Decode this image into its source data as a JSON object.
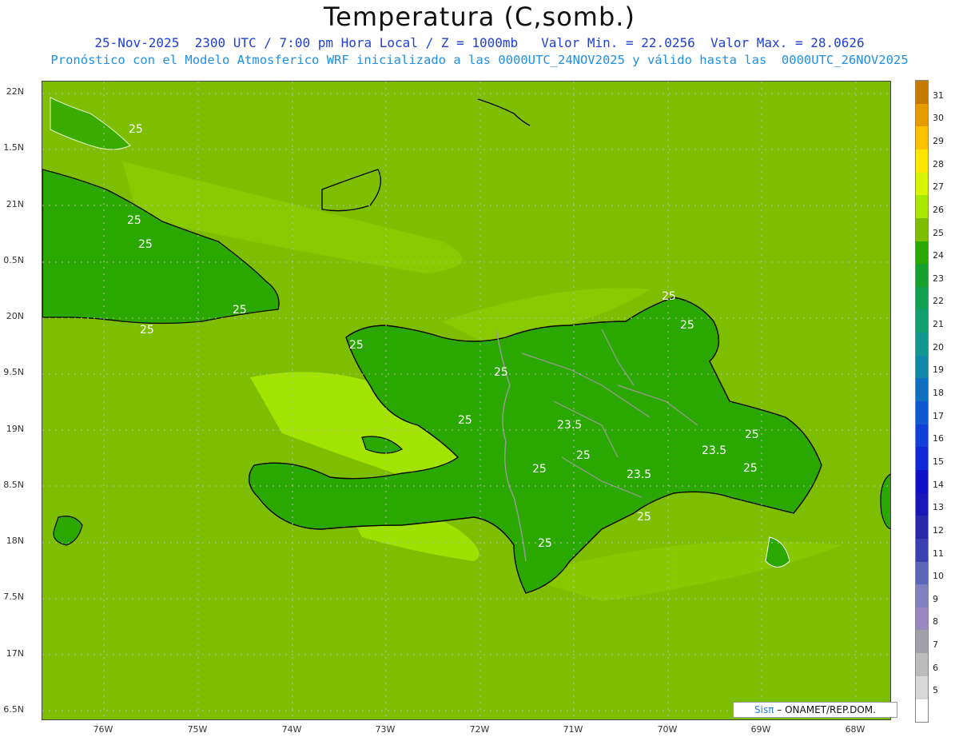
{
  "header": {
    "title": "Temperatura (C,somb.)",
    "line1": "25-Nov-2025  2300 UTC / 7:00 pm Hora Local / Z = 1000mb   Valor Min. = 22.0256  Valor Max. = 28.0626",
    "line2": "Pronóstico con el Modelo Atmosferico WRF inicializado a las 0000UTC_24NOV2025 y válido hasta las  0000UTC_26NOV2025"
  },
  "axes": {
    "lat_labels": [
      "22N",
      "1.5N",
      "21N",
      "0.5N",
      "20N",
      "9.5N",
      "19N",
      "8.5N",
      "18N",
      "7.5N",
      "17N",
      "6.5N"
    ],
    "lon_labels": [
      "76W",
      "75W",
      "74W",
      "73W",
      "72W",
      "71W",
      "70W",
      "69W",
      "68W"
    ]
  },
  "contour_labels": [
    "25",
    "25",
    "25",
    "25",
    "25",
    "25",
    "25",
    "25",
    "25",
    "25",
    "23.5",
    "23.5",
    "23.5",
    "25",
    "25",
    "25",
    "25",
    "25",
    "25"
  ],
  "colorbar": {
    "labels": [
      "31",
      "30",
      "29",
      "28",
      "27",
      "26",
      "25",
      "24",
      "23",
      "22",
      "21",
      "20",
      "19",
      "18",
      "17",
      "16",
      "15",
      "14",
      "13",
      "12",
      "11",
      "10",
      "9",
      "8",
      "7",
      "6",
      "5"
    ],
    "colors": [
      "#c57a00",
      "#e59a00",
      "#ffc000",
      "#ffe600",
      "#d6f500",
      "#a6e800",
      "#7dbf00",
      "#2aa800",
      "#18a02c",
      "#10a050",
      "#10a070",
      "#109890",
      "#1088a8",
      "#1070c0",
      "#1058d0",
      "#1040d8",
      "#1028d8",
      "#1010c8",
      "#1818b8",
      "#2828a8",
      "#3a40b0",
      "#5a66b8",
      "#8080c0",
      "#9a88c0",
      "#a0a0a8",
      "#bcbcbc",
      "#d8d8d8"
    ]
  },
  "credit": {
    "brand": "Sisπ",
    "org": " – ONAMET/REP.DOM."
  }
}
